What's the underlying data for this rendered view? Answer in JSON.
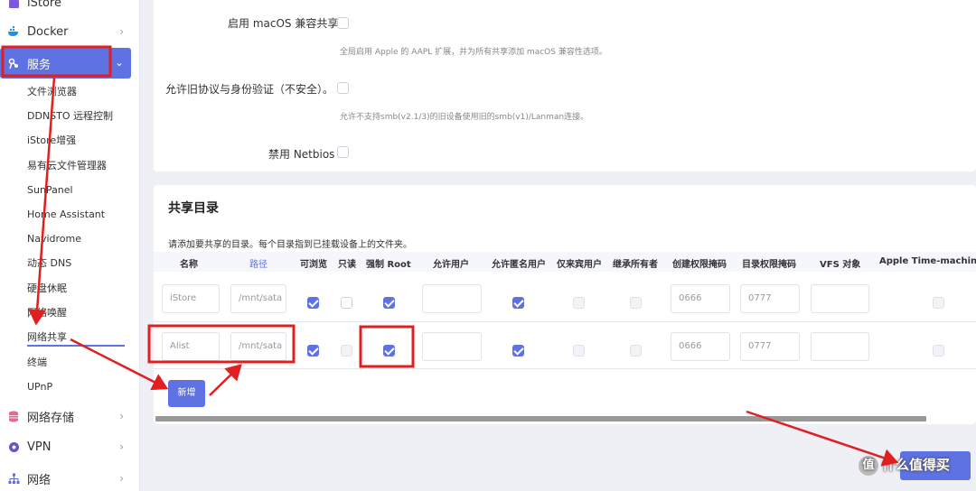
{
  "sidebar": {
    "top_partial": "iStore",
    "docker": "Docker",
    "services": "服务",
    "sub": [
      "文件浏览器",
      "DDNSTO 远程控制",
      "iStore增强",
      "易有云文件管理器",
      "SunPanel",
      "Home Assistant",
      "Navidrome",
      "动态 DNS",
      "硬盘休眠",
      "网络唤醒",
      "网络共享",
      "终端",
      "UPnP"
    ],
    "storage": "网络存储",
    "vpn": "VPN",
    "network": "网络"
  },
  "options": {
    "macos_label": "启用 macOS 兼容共享",
    "macos_hint": "全局启用 Apple 的 AAPL 扩展，并为所有共享添加 macOS 兼容性选项。",
    "legacy_label": "允许旧协议与身份验证（不安全）。",
    "legacy_hint": "允许不支持smb(v2.1/3)的旧设备使用旧的smb(v1)/Lanman连接。",
    "netbios_label": "禁用 Netbios"
  },
  "shares": {
    "title": "共享目录",
    "desc": "请添加要共享的目录。每个目录指到已挂载设备上的文件夹。",
    "headers": [
      "名称",
      "路径",
      "可浏览",
      "只读",
      "强制 Root",
      "允许用户",
      "允许匿名用户",
      "仅来宾用户",
      "继承所有者",
      "创建权限掩码",
      "目录权限掩码",
      "VFS 对象",
      "Apple Time-machine"
    ],
    "rows": [
      {
        "name": "iStore",
        "path": "/mnt/sata",
        "create_mask": "0666",
        "dir_mask": "0777"
      },
      {
        "name": "Alist",
        "path": "/mnt/sata",
        "create_mask": "0666",
        "dir_mask": "0777"
      }
    ],
    "add_label": "新增"
  },
  "save_label": "保存",
  "watermark": "什么值得买",
  "colors": {
    "accent": "#5e72e4",
    "annotation": "#e02020"
  }
}
